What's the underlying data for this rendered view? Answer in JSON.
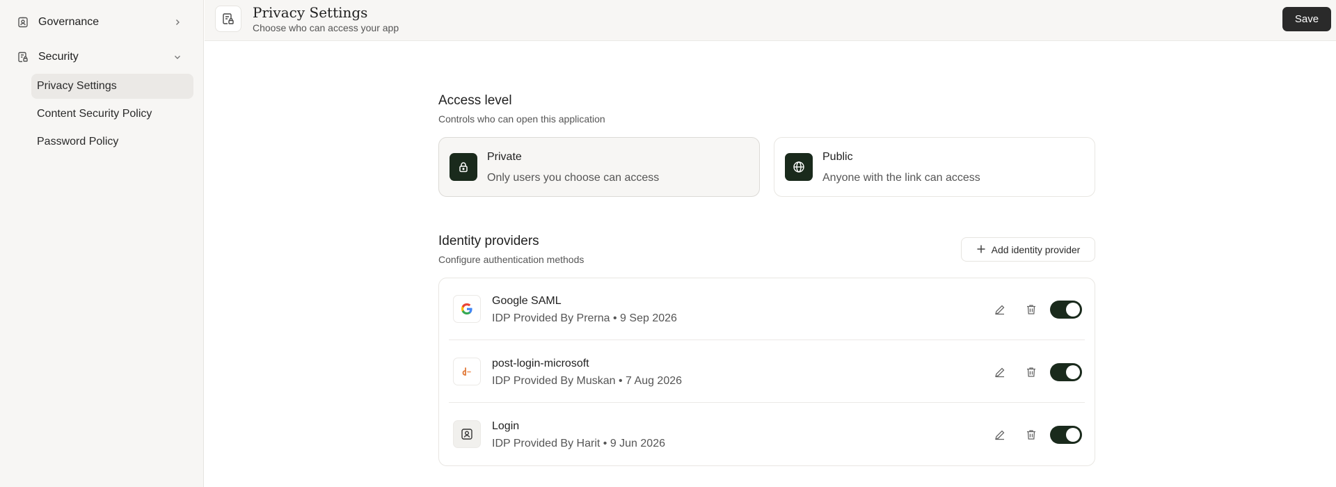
{
  "sidebar": {
    "groups": [
      {
        "label": "Governance",
        "icon": "badge-icon",
        "expanded": false
      },
      {
        "label": "Security",
        "icon": "shield-doc-icon",
        "expanded": true
      }
    ],
    "items": [
      {
        "label": "Privacy Settings",
        "active": true
      },
      {
        "label": "Content Security Policy",
        "active": false
      },
      {
        "label": "Password Policy",
        "active": false
      }
    ]
  },
  "header": {
    "title": "Privacy Settings",
    "subtitle": "Choose who can access your app",
    "save_label": "Save"
  },
  "access": {
    "title": "Access level",
    "subtitle": "Controls who can open this application",
    "options": [
      {
        "name": "Private",
        "description": "Only users you choose can access",
        "icon": "lock-icon",
        "selected": true
      },
      {
        "name": "Public",
        "description": "Anyone with the link can access",
        "icon": "globe-icon",
        "selected": false
      }
    ]
  },
  "identity": {
    "title": "Identity providers",
    "subtitle": "Configure authentication methods",
    "add_label": "Add identity provider",
    "providers": [
      {
        "name": "Google SAML",
        "meta": "IDP Provided By Prerna • 9 Sep 2026",
        "icon": "google-icon",
        "enabled": true
      },
      {
        "name": "post-login-microsoft",
        "meta": "IDP Provided By Muskan • 7 Aug 2026",
        "icon": "brand-d-icon",
        "enabled": true
      },
      {
        "name": "Login",
        "meta": "IDP Provided By Harit • 9 Jun 2026",
        "icon": "user-badge-icon",
        "enabled": true
      }
    ]
  },
  "colors": {
    "accent_dark": "#1a2a1c",
    "save_button": "#2a2a2a",
    "sidebar_bg": "#f7f6f4",
    "active_item_bg": "#ebe9e6"
  }
}
